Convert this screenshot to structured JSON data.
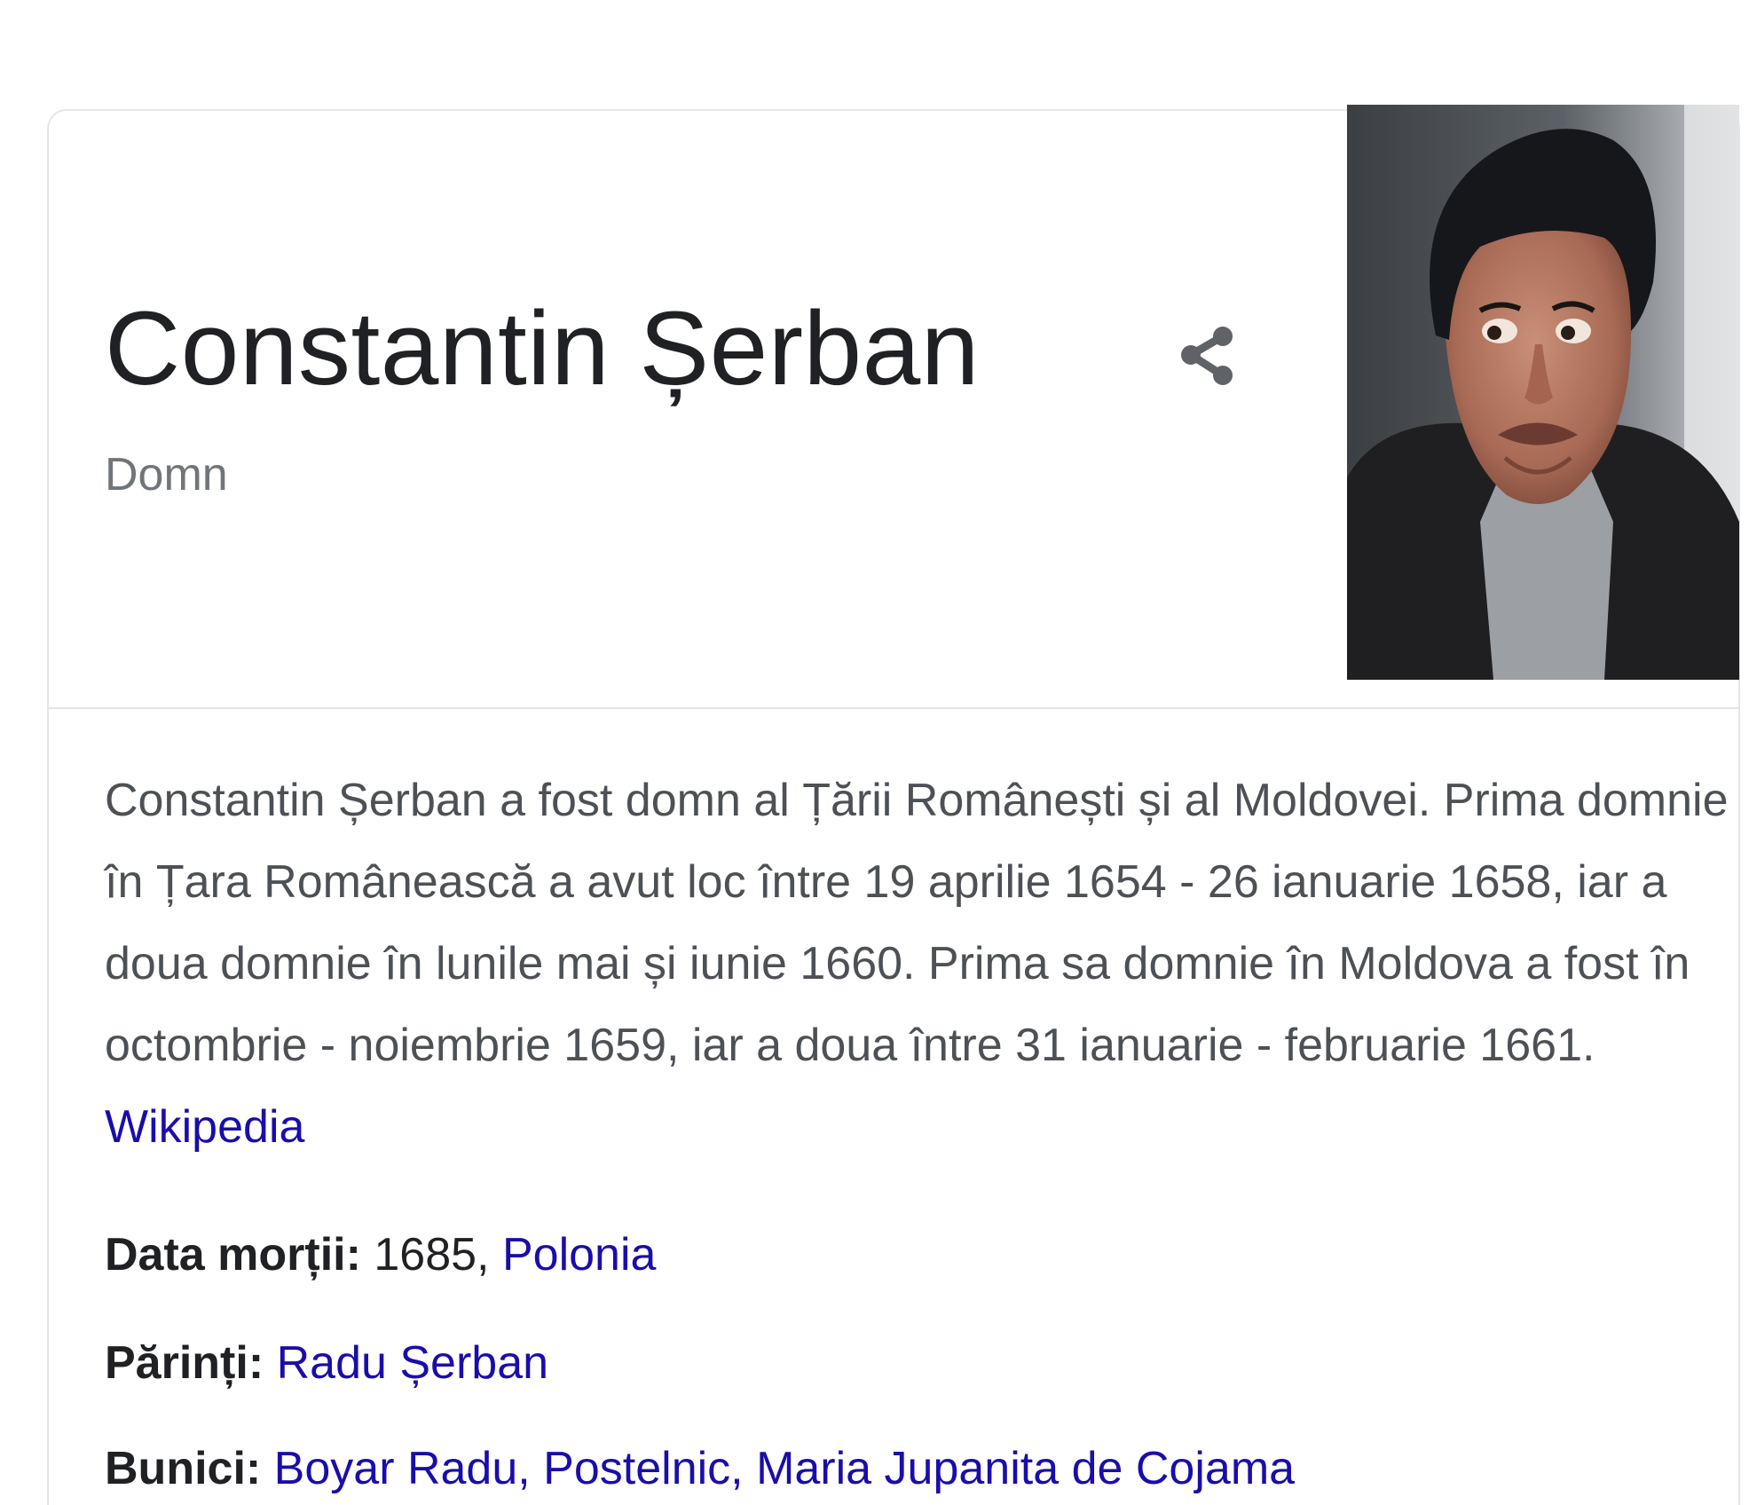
{
  "header": {
    "title": "Constantin Șerban",
    "subtitle": "Domn"
  },
  "icons": {
    "share": "share-icon"
  },
  "image": {
    "description": "portrait-photo"
  },
  "description": {
    "text": "Constantin Șerban a fost domn al Țării Românești și al Moldovei. Prima domnie în Țara Românească a avut loc între 19 aprilie 1654 - 26 ianuarie 1658, iar a doua domnie în lunile mai și iunie 1660. Prima sa domnie în Moldova a fost în octombrie - noiembrie 1659, iar a doua între 31 ianuarie - februarie 1661.",
    "source_link": "Wikipedia"
  },
  "facts": {
    "death": {
      "label": "Data morții:",
      "value": "1685,",
      "link": "Polonia"
    },
    "parents": {
      "label": "Părinți:",
      "link": "Radu Șerban"
    },
    "grandparents": {
      "label": "Bunici:",
      "link_1": "Boyar Radu, Postelnic,",
      "link_2": "Maria Jupanita de Cojama"
    }
  },
  "colors": {
    "title": "#202124",
    "subtitle": "#70757a",
    "body_text": "#4d5156",
    "link": "#1a0dab",
    "icon": "#5f6368",
    "border": "#e4e6ea"
  }
}
